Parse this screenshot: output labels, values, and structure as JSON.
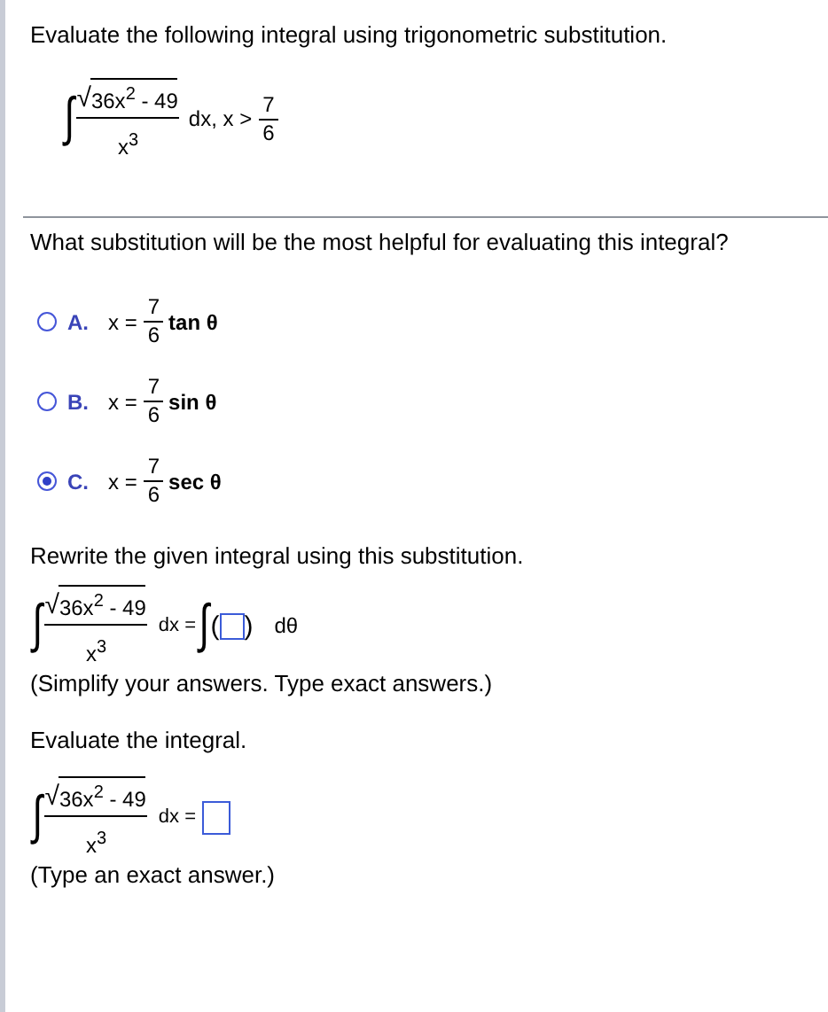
{
  "instruction": "Evaluate the following integral using trigonometric substitution.",
  "given": {
    "sign": "∫",
    "radical": "√",
    "radicand": "36x$^{2}$ - 49",
    "denominator": "x$^{3}$",
    "tail": "dx, x >",
    "bound_num": "7",
    "bound_den": "6"
  },
  "question": "What substitution will be the most helpful for evaluating this integral?",
  "options": [
    {
      "letter": "A.",
      "lhs": "x =",
      "num": "7",
      "den": "6",
      "func": "tan θ",
      "selected": false
    },
    {
      "letter": "B.",
      "lhs": "x =",
      "num": "7",
      "den": "6",
      "func": "sin θ",
      "selected": false
    },
    {
      "letter": "C.",
      "lhs": "x =",
      "num": "7",
      "den": "6",
      "func": "sec θ",
      "selected": true
    }
  ],
  "rewrite": {
    "prompt": "Rewrite the given integral using this substitution.",
    "sign": "∫",
    "radical": "√",
    "radicand": "36x$^{2}$ - 49",
    "denominator": "x$^{3}$",
    "equals": "dx =",
    "sign2": "∫",
    "open": "(",
    "close": ")",
    "dtheta": "dθ",
    "note": "(Simplify your answers. Type exact answers.)"
  },
  "evaluate": {
    "prompt": "Evaluate the integral.",
    "sign": "∫",
    "radical": "√",
    "radicand": "36x$^{2}$ - 49",
    "denominator": "x$^{3}$",
    "equals": "dx =",
    "note": "(Type an exact answer.)"
  }
}
